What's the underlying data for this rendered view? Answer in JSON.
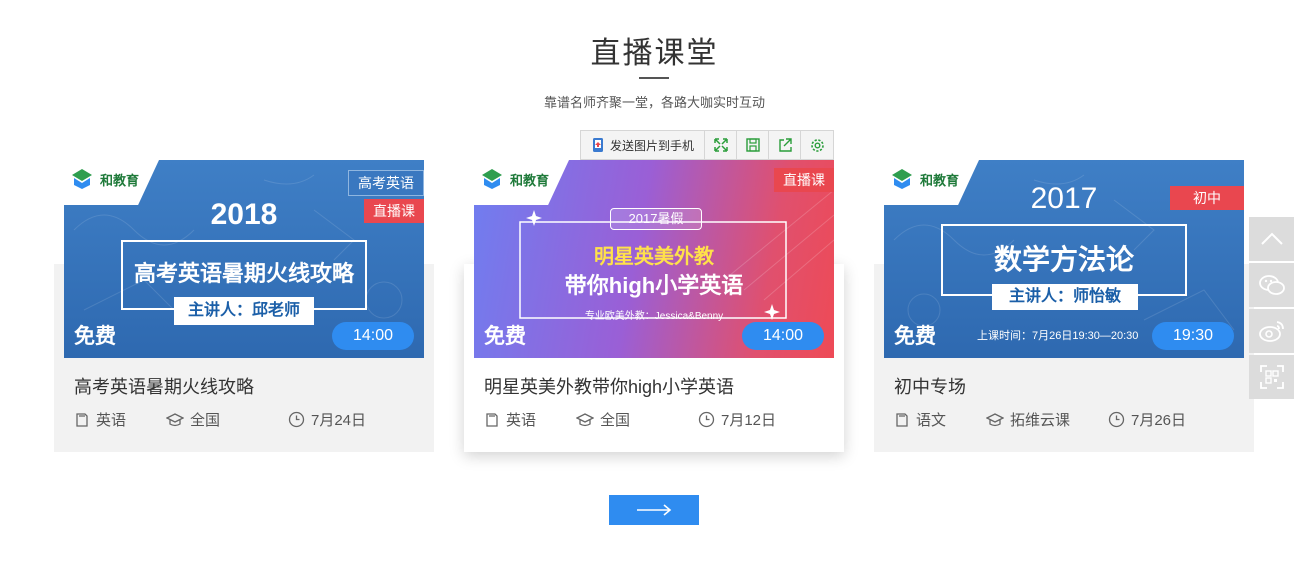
{
  "section": {
    "title": "直播课堂",
    "subtitle": "靠谱名师齐聚一堂，各路大咖实时互动"
  },
  "image_toolbar": {
    "send_label": "发送图片到手机",
    "buttons": [
      "expand-icon",
      "save-icon",
      "share-icon",
      "settings-icon"
    ]
  },
  "cards": [
    {
      "banner": {
        "logo_text": "和教育",
        "tags": [
          "高考英语",
          "直播课"
        ],
        "year": "2018",
        "headline": "高考英语暑期火线攻略",
        "lecturer": "主讲人：邱老师",
        "free_label": "免费",
        "time": "14:00"
      },
      "title": "高考英语暑期火线攻略",
      "subject": "英语",
      "region": "全国",
      "date": "7月24日"
    },
    {
      "banner": {
        "logo_text": "和教育",
        "tags": [
          "直播课"
        ],
        "badge": "2017暑假",
        "headline_line1": "明星英美外教",
        "headline_line2": "带你high小学英语",
        "teacher_line": "专业欧美外教：Jessica&Benny",
        "free_label": "免费",
        "time": "14:00"
      },
      "title": "明星英美外教带你high小学英语",
      "subject": "英语",
      "region": "全国",
      "date": "7月12日"
    },
    {
      "banner": {
        "logo_text": "和教育",
        "tags": [
          "初中"
        ],
        "year": "2017",
        "headline": "数学方法论",
        "lecturer": "主讲人：师怡敏",
        "schedule": "上课时间：7月26日19:30—20:30",
        "free_label": "免费",
        "time": "19:30"
      },
      "title": "初中专场",
      "subject": "语文",
      "region": "拓维云课",
      "date": "7月26日"
    }
  ],
  "sidebar": {
    "items": [
      "back-to-top-icon",
      "wechat-icon",
      "weibo-icon",
      "qrcode-icon"
    ]
  },
  "more_button": {
    "icon": "arrow-right-icon"
  },
  "colors": {
    "accent_blue": "#2f8cf0",
    "tag_red": "#e9474f",
    "banner_blue": "#2f6db5"
  }
}
